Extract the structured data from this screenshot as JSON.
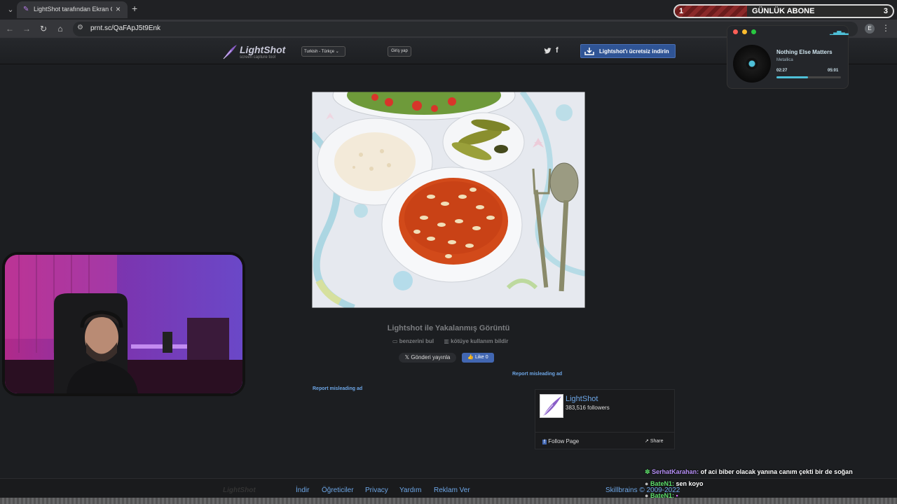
{
  "browser": {
    "tab_title": "LightShot tarafından Ekran Görüntüsü",
    "url": "prnt.sc/QaFApJ5t9Enk",
    "profile_initial": "E"
  },
  "lightshot": {
    "logo_text": "LightShot",
    "logo_subtitle": "screen capture tool",
    "language": "Turkish - Türkçe",
    "login_label": "Giriş yap",
    "download_label": "Lightshot'ı ücretsiz indirin",
    "caption": "Lightshot ile Yakalanmış Görüntü",
    "find_similar": "benzerini bul",
    "report_abuse": "kötüye kullanım bildir",
    "tweet_label": "Gönderi yayınla",
    "like_label": "Like 0",
    "report_ad": "Report misleading ad"
  },
  "facebook_widget": {
    "page_name": "LightShot",
    "followers": "383,516 followers",
    "follow_label": "Follow Page",
    "share_label": "Share"
  },
  "footer": {
    "logo": "LightShot",
    "links": [
      "İndir",
      "Öğreticiler",
      "Privacy",
      "Yardım",
      "Reklam Ver"
    ],
    "copyright": "Skillbrains © 2009-2022"
  },
  "stream": {
    "sub_goal": {
      "current": "1",
      "label": "GÜNLÜK ABONE",
      "target": "3",
      "fill_fraction": 0.33
    },
    "music": {
      "track": "Nothing Else Matters",
      "artist": "Metallica",
      "current_time": "02:27",
      "total_time": "05:01",
      "progress_fraction": 0.49
    },
    "chat": [
      {
        "user": "SerhatKarahan:",
        "message": "of aci biber olacak yanına canım çekti bir de soğan"
      },
      {
        "user": "BateN1:",
        "message": "sen koyo"
      },
      {
        "user": "BateN1:",
        "message": ""
      }
    ]
  },
  "colors": {
    "link": "#6da6e6",
    "download_button": "#2f5495",
    "accent_music": "#4ec0d8"
  }
}
